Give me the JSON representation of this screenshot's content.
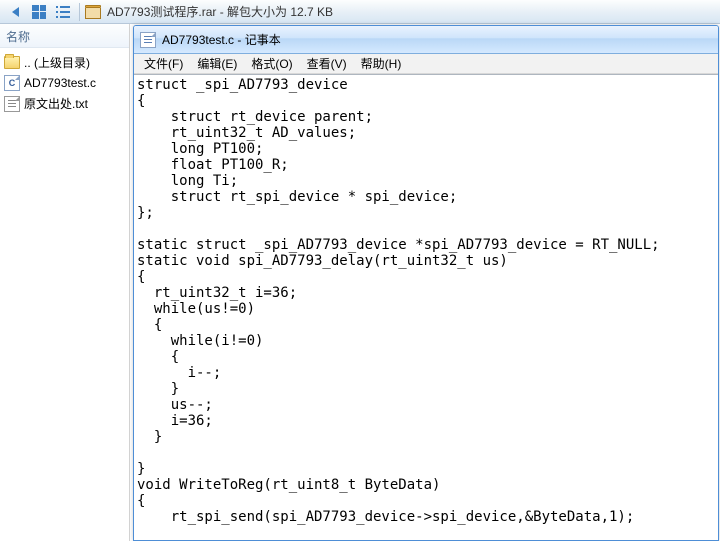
{
  "toolbar": {
    "archive_title": "AD7793测试程序.rar - 解包大小为 12.7 KB"
  },
  "tree": {
    "header": "名称",
    "items": [
      {
        "label": ".. (上级目录)"
      },
      {
        "label": "AD7793test.c"
      },
      {
        "label": "原文出处.txt"
      }
    ]
  },
  "notepad": {
    "title": "AD7793test.c - 记事本",
    "menu": {
      "file": "文件(F)",
      "edit": "编辑(E)",
      "format": "格式(O)",
      "view": "查看(V)",
      "help": "帮助(H)"
    },
    "content": "struct _spi_AD7793_device\n{\n    struct rt_device parent;\n    rt_uint32_t AD_values;\n    long PT100;\n    float PT100_R;\n    long Ti;\n    struct rt_spi_device * spi_device;\n};\n\nstatic struct _spi_AD7793_device *spi_AD7793_device = RT_NULL;\nstatic void spi_AD7793_delay(rt_uint32_t us)\n{\n  rt_uint32_t i=36;\n  while(us!=0)\n  {\n    while(i!=0)\n    {\n      i--;\n    }\n    us--;\n    i=36;\n  }\n\n}\nvoid WriteToReg(rt_uint8_t ByteData)\n{\n    rt_spi_send(spi_AD7793_device->spi_device,&ByteData,1);"
  }
}
